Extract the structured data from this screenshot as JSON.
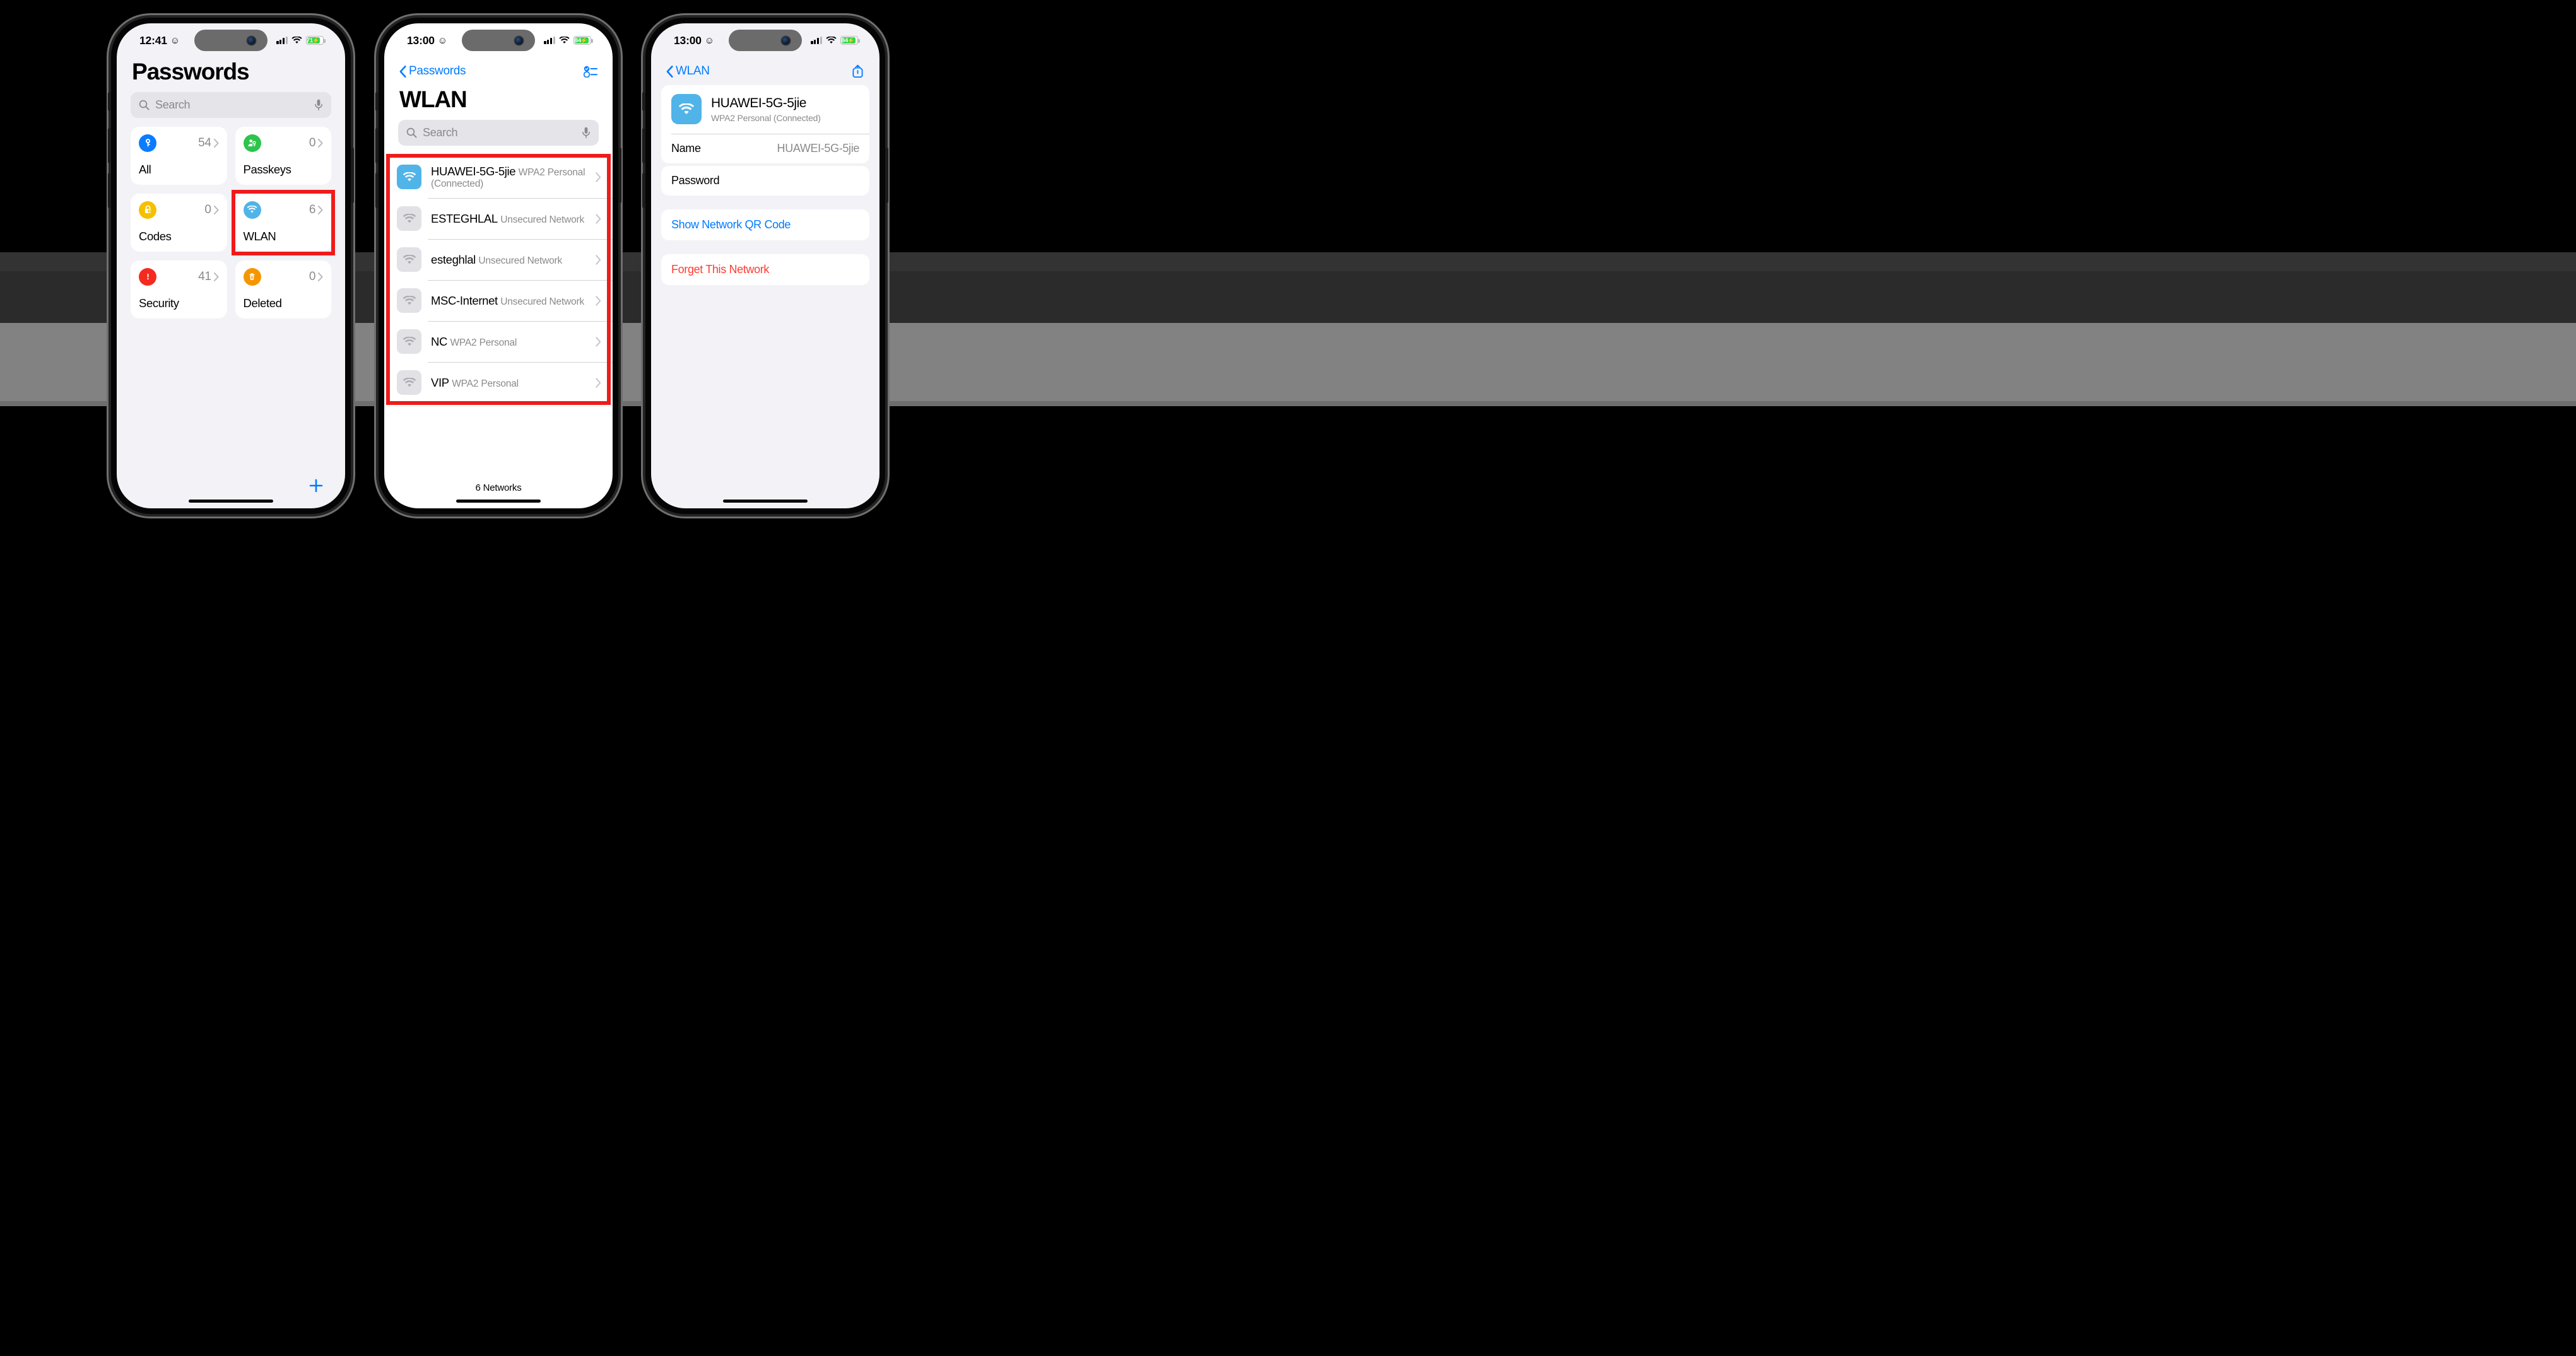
{
  "phones": [
    {
      "id": "passwords-home",
      "status": {
        "time": "12:41",
        "emoji": "☺",
        "battery": "71",
        "battery_color": "#32d74b"
      },
      "title": "Passwords",
      "search": {
        "placeholder": "Search"
      },
      "grid": [
        {
          "label": "All",
          "count": "54",
          "icon": "key-icon",
          "icon_color": "#0a7cff",
          "highlighted": false
        },
        {
          "label": "Passkeys",
          "count": "0",
          "icon": "passkey-icon",
          "icon_color": "#2dc44d",
          "highlighted": false
        },
        {
          "label": "Codes",
          "count": "0",
          "icon": "lock-clock-icon",
          "icon_color": "#f5c000",
          "highlighted": false
        },
        {
          "label": "WLAN",
          "count": "6",
          "icon": "wifi-icon",
          "icon_color": "#50b4e8",
          "highlighted": true
        },
        {
          "label": "Security",
          "count": "41",
          "icon": "warning-icon",
          "icon_color": "#f52b20",
          "highlighted": false
        },
        {
          "label": "Deleted",
          "count": "0",
          "icon": "trash-icon",
          "icon_color": "#f59600",
          "highlighted": false
        }
      ],
      "add_button": "add-password-button"
    },
    {
      "id": "wlan-list",
      "status": {
        "time": "13:00",
        "emoji": "☺",
        "battery": "84",
        "battery_color": "#32d74b"
      },
      "nav": {
        "back_label": "Passwords",
        "right_icon": "select-list-icon"
      },
      "title": "WLAN",
      "search": {
        "placeholder": "Search"
      },
      "networks": [
        {
          "name": "HUAWEI-5G-5jie",
          "security": "WPA2 Personal (Connected)",
          "connected": true
        },
        {
          "name": "ESTEGHLAL",
          "security": "Unsecured Network",
          "connected": false
        },
        {
          "name": "esteghlal",
          "security": "Unsecured Network",
          "connected": false
        },
        {
          "name": "MSC-Internet",
          "security": "Unsecured Network",
          "connected": false
        },
        {
          "name": "NC",
          "security": "WPA2 Personal",
          "connected": false
        },
        {
          "name": "VIP",
          "security": "WPA2 Personal",
          "connected": false
        }
      ],
      "footer": "6 Networks"
    },
    {
      "id": "network-detail",
      "status": {
        "time": "13:00",
        "emoji": "☺",
        "battery": "84",
        "battery_color": "#32d74b"
      },
      "nav": {
        "back_label": "WLAN",
        "right_icon": "share-icon"
      },
      "header": {
        "title": "HUAWEI-5G-5jie",
        "subtitle": "WPA2 Personal (Connected)"
      },
      "rows": [
        {
          "label": "Name",
          "value": "HUAWEI-5G-5jie",
          "highlighted": false
        },
        {
          "label": "Password",
          "value": "",
          "highlighted": true
        }
      ],
      "actions": [
        {
          "label": "Show Network QR Code",
          "style": "blue"
        },
        {
          "label": "Forget This Network",
          "style": "red"
        }
      ]
    }
  ],
  "colors": {
    "accent_blue": "#007aff",
    "destructive_red": "#ff3b30",
    "highlight_red": "#ef1b1b",
    "screen_bg": "#f2f2f7",
    "card_bg": "#ffffff"
  }
}
